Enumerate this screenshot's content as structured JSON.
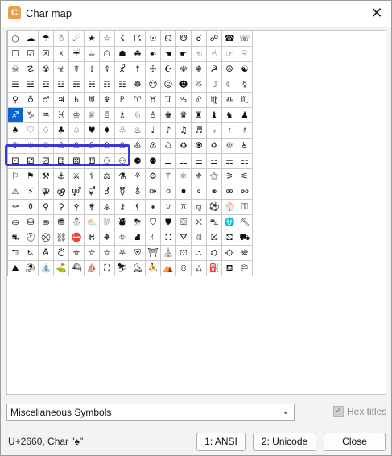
{
  "window": {
    "title": "Char map",
    "icon_letter": "C",
    "close_glyph": "✕",
    "icon_color": "#e8a24a"
  },
  "grid": {
    "selected_index": 80,
    "rows": [
      [
        "○",
        "☁",
        "☂",
        "☃",
        "☄",
        "★",
        "☆",
        "☇",
        "☈",
        "☉",
        "☊",
        "☋",
        "☌",
        "☍",
        "☎",
        "☏"
      ],
      [
        "☐",
        "☑",
        "☒",
        "☓",
        "☔",
        "☕",
        "☖",
        "☗",
        "☘",
        "☙",
        "☚",
        "☛",
        "☜",
        "☝",
        "☞",
        "☟"
      ],
      [
        "☠",
        "☡",
        "☢",
        "☣",
        "☤",
        "☥",
        "☦",
        "☧",
        "☨",
        "☩",
        "☪",
        "☫",
        "☬",
        "☭",
        "☮",
        "☯"
      ],
      [
        "☰",
        "☱",
        "☲",
        "☳",
        "☴",
        "☵",
        "☶",
        "☷",
        "☸",
        "☹",
        "☺",
        "☻",
        "☼",
        "☽",
        "☾",
        "☿"
      ],
      [
        "♀",
        "♁",
        "♂",
        "♃",
        "♄",
        "♅",
        "♆",
        "♇",
        "♈",
        "♉",
        "♊",
        "♋",
        "♌",
        "♍",
        "♎",
        "♏"
      ],
      [
        "♐",
        "♑",
        "♒",
        "♓",
        "♔",
        "♕",
        "♖",
        "♗",
        "♘",
        "♙",
        "♚",
        "♛",
        "♜",
        "♝",
        "♞",
        "♟"
      ],
      [
        "♠",
        "♡",
        "♢",
        "♣",
        "♤",
        "♥",
        "♦",
        "♧",
        "♨",
        "♩",
        "♪",
        "♫",
        "♬",
        "♭",
        "♮",
        "♯"
      ],
      [
        "♰",
        "♱",
        "♲",
        "♳",
        "♴",
        "♵",
        "♶",
        "♷",
        "♸",
        "♹",
        "♺",
        "♻",
        "♼",
        "♽",
        "♾",
        "♿"
      ],
      [
        "⚀",
        "⚁",
        "⚂",
        "⚃",
        "⚄",
        "⚅",
        "⚆",
        "⚇",
        "⚈",
        "⚉",
        "⚊",
        "⚋",
        "⚌",
        "⚍",
        "⚎",
        "⚏"
      ],
      [
        "⚐",
        "⚑",
        "⚒",
        "⚓",
        "⚔",
        "⚕",
        "⚖",
        "⚗",
        "⚘",
        "⚙",
        "⚚",
        "⚛",
        "⚜",
        "⚝",
        "⚞",
        "⚟"
      ],
      [
        "⚠",
        "⚡",
        "⚢",
        "⚣",
        "⚤",
        "⚥",
        "⚦",
        "⚧",
        "⚨",
        "⚩",
        "⚪",
        "⚫",
        "⚬",
        "⚭",
        "⚮",
        "⚯"
      ],
      [
        "⚰",
        "⚱",
        "⚲",
        "⚳",
        "⚴",
        "⚵",
        "⚶",
        "⚷",
        "⚸",
        "⚹",
        "⚺",
        "⚻",
        "⚼",
        "⚽",
        "⚾",
        "⚿"
      ],
      [
        "⛀",
        "⛁",
        "⛂",
        "⛃",
        "⛄",
        "⛅",
        "⛆",
        "⛇",
        "⛈",
        "⛉",
        "⛊",
        "⛋",
        "⛌",
        "⛍",
        "⛎",
        "⛏"
      ],
      [
        "⛐",
        "⛑",
        "⛒",
        "⛓",
        "⛔",
        "⛕",
        "⛖",
        "⛗",
        "⛘",
        "⛙",
        "⛚",
        "⛛",
        "⛜",
        "⛝",
        "⛞",
        "⛟"
      ],
      [
        "⛠",
        "⛡",
        "⛢",
        "⛣",
        "⛤",
        "⛥",
        "⛦",
        "⛧",
        "⛨",
        "⛩",
        "⛪",
        "⛫",
        "⛬",
        "⛭",
        "⛮",
        "⛯"
      ],
      [
        "⛰",
        "⛱",
        "⛲",
        "⛳",
        "⛴",
        "⛵",
        "⛶",
        "⛷",
        "⛸",
        "⛹",
        "⛺",
        "⛻",
        "⛼",
        "⛽",
        "⛾",
        "⛿"
      ]
    ]
  },
  "controls": {
    "block_select": "Miscellaneous Symbols",
    "combo_arrow": "⌄",
    "hex_titles_label": "Hex titles",
    "hex_titles_checked": true,
    "hex_check_glyph": "✓"
  },
  "status": {
    "text": "U+2660, Char \"♠\""
  },
  "buttons": {
    "ansi": "1: ANSI",
    "unicode": "2: Unicode",
    "close": "Close"
  },
  "colors": {
    "selection": "#0a64d2",
    "highlight_border": "#3a35d6"
  }
}
